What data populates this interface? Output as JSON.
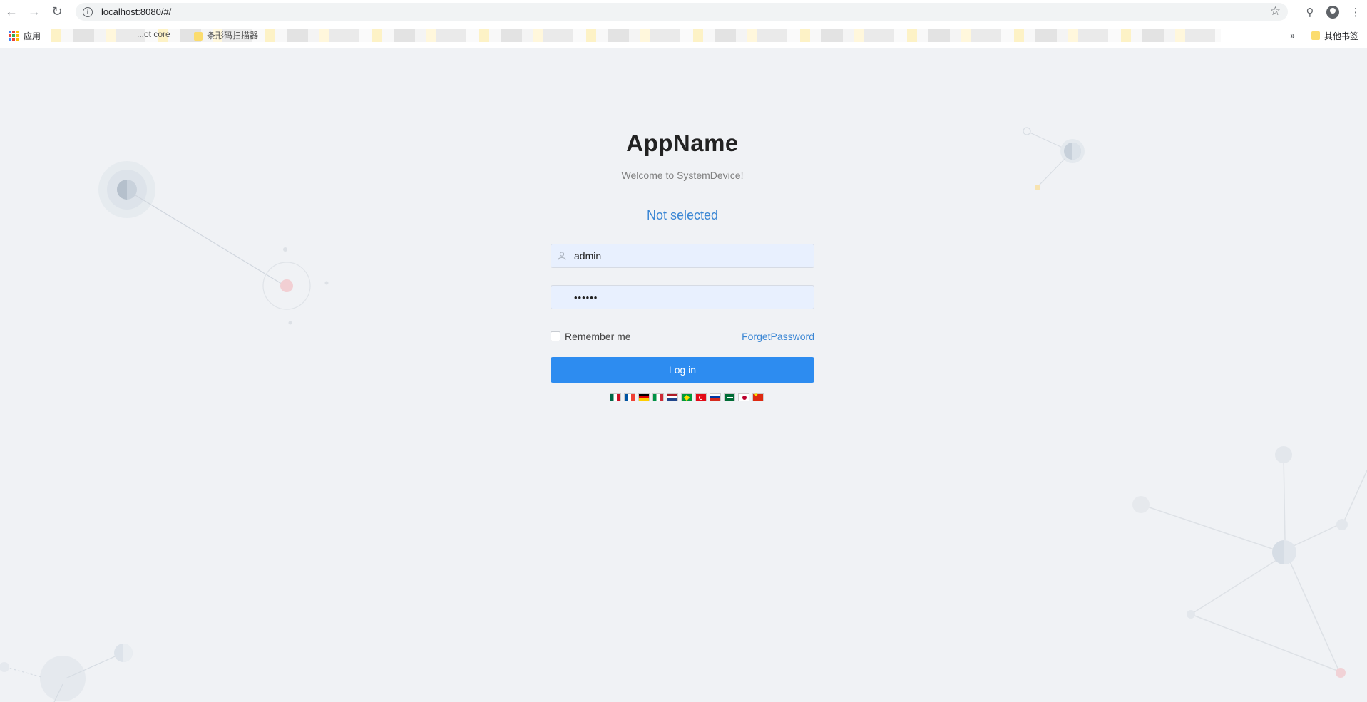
{
  "browser": {
    "url": "localhost:8080/#/",
    "bookmarks": {
      "apps_label": "应用",
      "item_1": "...ot core",
      "item_2": "条形码扫描器",
      "other_label": "其他书签"
    }
  },
  "login": {
    "app_name": "AppName",
    "welcome": "Welcome to SystemDevice!",
    "system_select": "Not selected",
    "username_value": "admin",
    "password_value": "••••••",
    "remember_label": "Remember me",
    "forgot_label": "ForgetPassword",
    "login_button": "Log in"
  },
  "languages": [
    {
      "name": "mexico-flag"
    },
    {
      "name": "france-flag"
    },
    {
      "name": "germany-flag"
    },
    {
      "name": "italy-flag"
    },
    {
      "name": "netherlands-flag"
    },
    {
      "name": "brazil-flag"
    },
    {
      "name": "turkey-flag"
    },
    {
      "name": "russia-flag"
    },
    {
      "name": "saudi-arabia-flag"
    },
    {
      "name": "japan-flag"
    },
    {
      "name": "china-flag"
    }
  ],
  "colors": {
    "primary": "#2d8cf0",
    "link": "#3a86d4",
    "background": "#f0f2f5",
    "input_bg": "#e8f0fe"
  }
}
